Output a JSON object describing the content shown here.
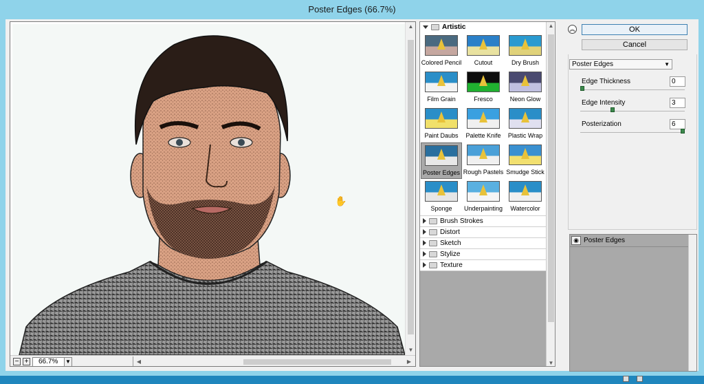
{
  "window": {
    "title": "Poster Edges (66.7%)"
  },
  "preview": {
    "zoom": "66.7%",
    "zoom_out": "−",
    "zoom_in": "+"
  },
  "gallery": {
    "artistic_label": "Artistic",
    "thumbnails": [
      "Colored Pencil",
      "Cutout",
      "Dry Brush",
      "Film Grain",
      "Fresco",
      "Neon Glow",
      "Paint Daubs",
      "Palette Knife",
      "Plastic Wrap",
      "Poster Edges",
      "Rough Pastels",
      "Smudge Stick",
      "Sponge",
      "Underpainting",
      "Watercolor"
    ],
    "selected": "Poster Edges",
    "categories": [
      "Brush Strokes",
      "Distort",
      "Sketch",
      "Stylize",
      "Texture"
    ]
  },
  "panel": {
    "ok": "OK",
    "cancel": "Cancel",
    "filter_select": "Poster Edges",
    "params": [
      {
        "label": "Edge Thickness",
        "value": "0"
      },
      {
        "label": "Edge Intensity",
        "value": "3"
      },
      {
        "label": "Posterization",
        "value": "6"
      }
    ],
    "slider_levels": [
      0.0,
      0.3,
      1.0
    ],
    "layer": "Poster Edges"
  },
  "colors": {
    "title_bar": "#8fd3ea",
    "dialog_bg": "#f0f0f0",
    "gallery_bg": "#a9a9a9",
    "slider_knob": "#3d8a4d"
  }
}
